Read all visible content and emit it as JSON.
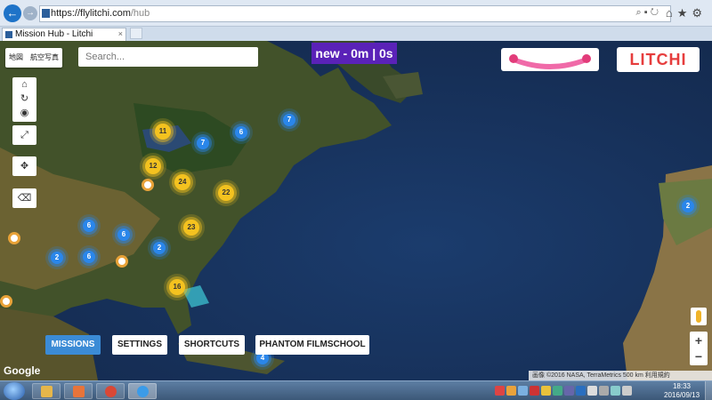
{
  "browser": {
    "url_host": "https://flylitchi.com",
    "url_path": "/hub",
    "tab_title": "Mission Hub - Litchi",
    "tab_close": "×"
  },
  "map": {
    "type_buttons": [
      "地図",
      "航空写真"
    ],
    "search_placeholder": "Search...",
    "counter": "new - 0m | 0s",
    "logo": "LITCHI",
    "google": "Google",
    "attribution": "画像 ©2016 NASA, TerraMetrics   500 km   利用規約",
    "clusters": [
      {
        "value": "11",
        "color": "yellow"
      },
      {
        "value": "7",
        "color": "blue"
      },
      {
        "value": "6",
        "color": "blue"
      },
      {
        "value": "7",
        "color": "blue"
      },
      {
        "value": "12",
        "color": "yellow"
      },
      {
        "value": "24",
        "color": "yellow"
      },
      {
        "value": "22",
        "color": "yellow"
      },
      {
        "value": "6",
        "color": "blue"
      },
      {
        "value": "6",
        "color": "blue"
      },
      {
        "value": "23",
        "color": "yellow"
      },
      {
        "value": "2",
        "color": "blue"
      },
      {
        "value": "2",
        "color": "blue"
      },
      {
        "value": "6",
        "color": "blue"
      },
      {
        "value": "16",
        "color": "yellow"
      },
      {
        "value": "2",
        "color": "blue"
      },
      {
        "value": "4",
        "color": "blue"
      }
    ],
    "buttons": {
      "missions": "MISSIONS",
      "settings": "SETTINGS",
      "shortcuts": "SHORTCUTS",
      "filmschool": "PHANTOM FILMSCHOOL"
    },
    "zoom_in": "+",
    "zoom_out": "−"
  },
  "taskbar": {
    "time": "18:33",
    "date": "2016/09/13"
  },
  "colors": {
    "accent": "#3b8bd6",
    "counter_bg": "#5a22b8",
    "cluster_yellow": "#f4c21f",
    "cluster_blue": "#2a86ea"
  }
}
